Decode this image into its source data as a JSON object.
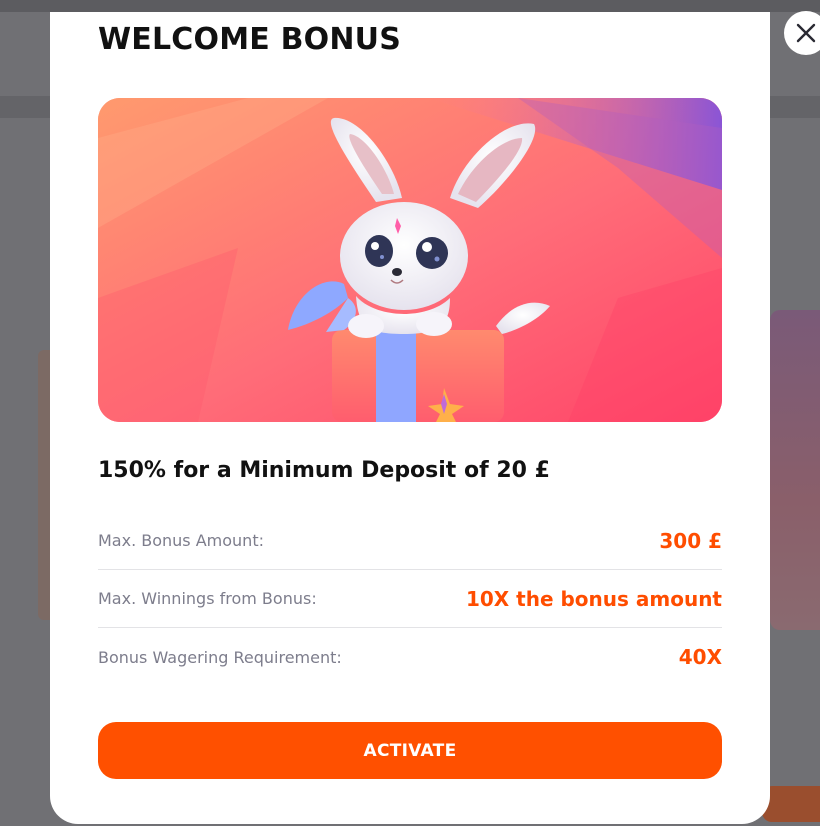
{
  "modal": {
    "title": "WELCOME BONUS",
    "headline": "150% for a Minimum Deposit of 20 £",
    "details": [
      {
        "label": "Max. Bonus Amount:",
        "value": "300 £"
      },
      {
        "label": "Max. Winnings from Bonus:",
        "value": "10X the bonus amount"
      },
      {
        "label": "Bonus Wagering Requirement:",
        "value": "40X"
      }
    ],
    "activate_label": "ACTIVATE",
    "close_icon": "close-icon",
    "hero_image": "white fennec fox in gift box illustration"
  },
  "colors": {
    "accent": "#ff5000",
    "value_text": "#ff4d00",
    "label_text": "#7d7d8c",
    "overlay": "#707074"
  }
}
